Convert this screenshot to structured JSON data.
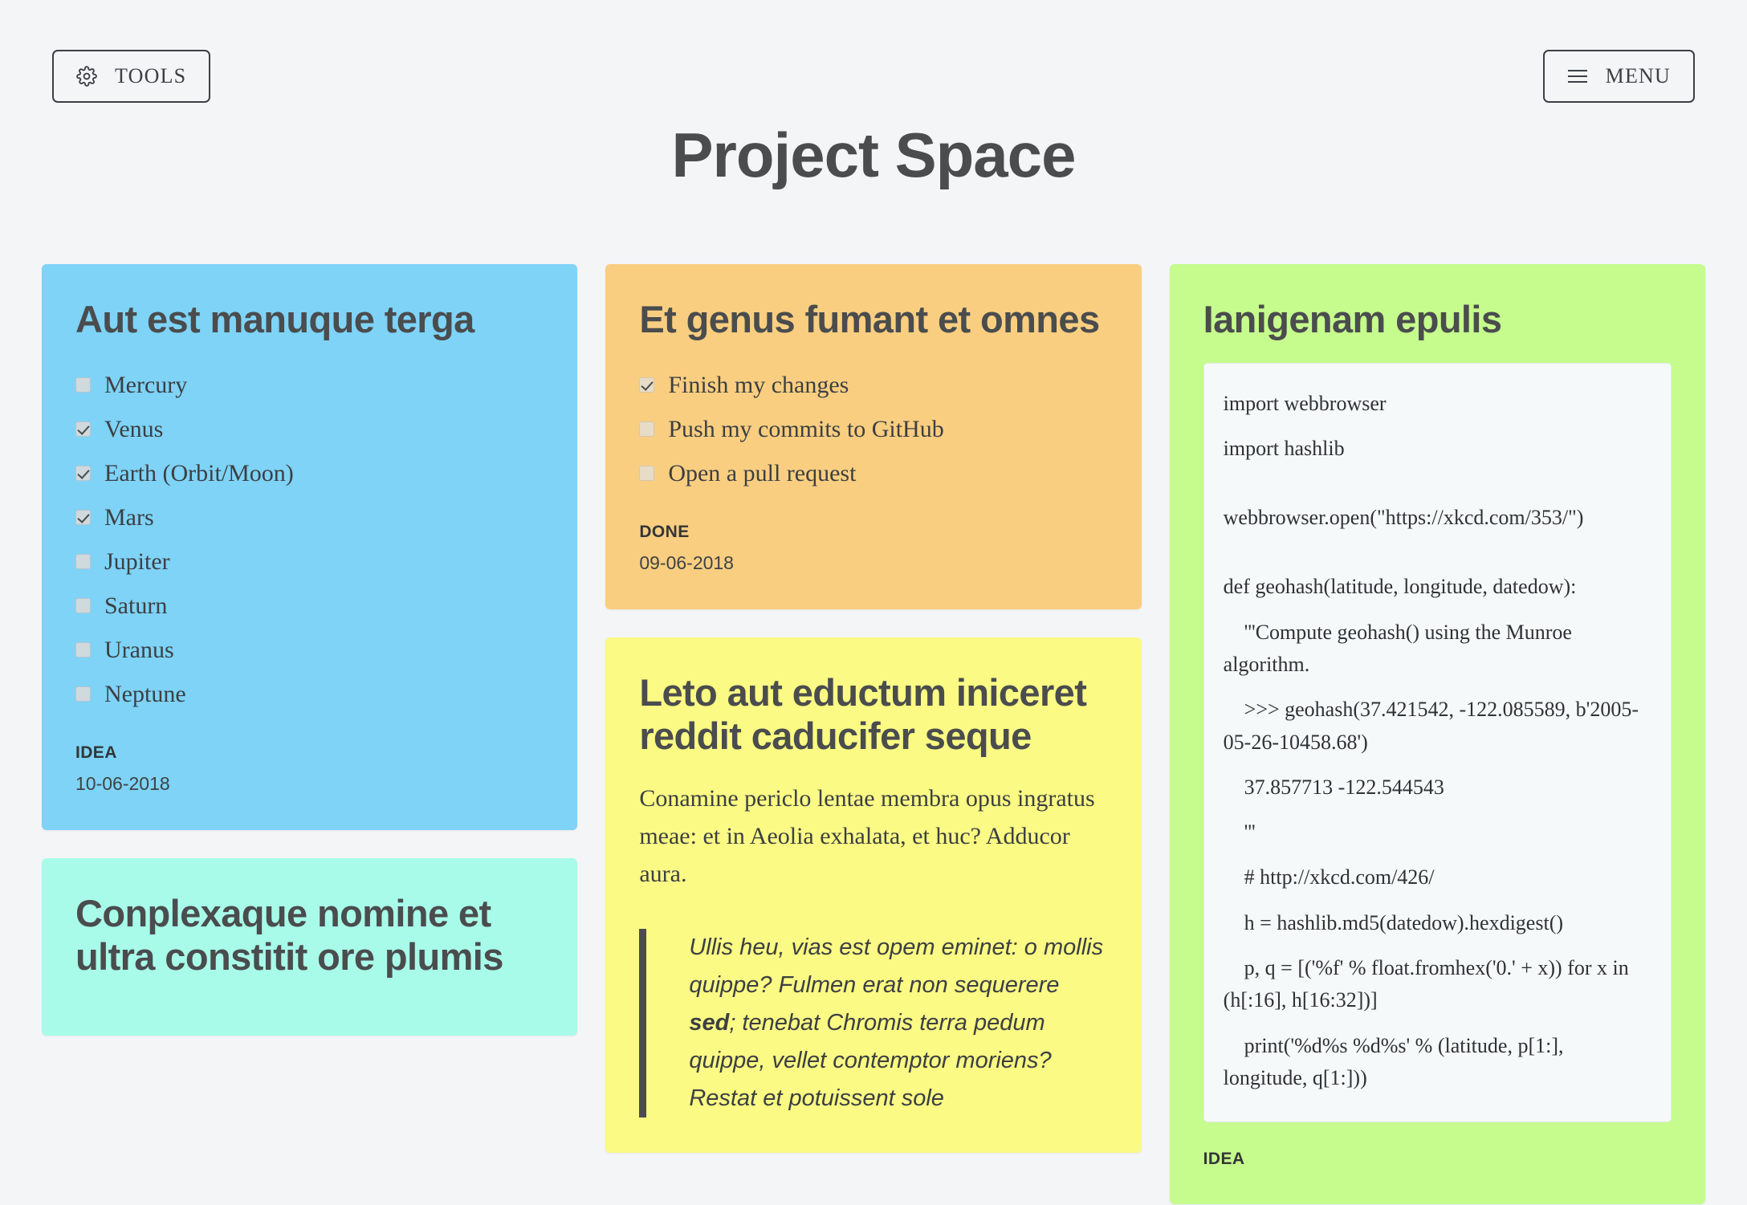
{
  "header": {
    "title": "Project Space",
    "tools_button": "TOOLS",
    "menu_button": "MENU",
    "tools_icon": "gear-icon",
    "menu_icon": "hamburger-icon"
  },
  "colors": {
    "background": "#f4f5f6",
    "blue_card": "#7ed3f7",
    "teal_card": "#a8fbe9",
    "orange_card": "#f9ce80",
    "yellow_card": "#fafa84",
    "green_card": "#c5fc8d",
    "text": "#4a4c4d",
    "code_panel": "#f6f9fa"
  },
  "cards": {
    "planets": {
      "title": "Aut est manuque terga",
      "items": [
        {
          "label": "Mercury",
          "checked": false
        },
        {
          "label": "Venus",
          "checked": true
        },
        {
          "label": "Earth (Orbit/Moon)",
          "checked": true
        },
        {
          "label": "Mars",
          "checked": true
        },
        {
          "label": "Jupiter",
          "checked": false
        },
        {
          "label": "Saturn",
          "checked": false
        },
        {
          "label": "Uranus",
          "checked": false
        },
        {
          "label": "Neptune",
          "checked": false
        }
      ],
      "tag": "IDEA",
      "date": "10-06-2018"
    },
    "conplexaque": {
      "title": "Conplexaque nomine et ultra constitit ore plumis"
    },
    "tasks": {
      "title": "Et genus fumant et omnes",
      "items": [
        {
          "label": "Finish my changes",
          "checked": true
        },
        {
          "label": "Push my commits to GitHub",
          "checked": false
        },
        {
          "label": "Open a pull request",
          "checked": false
        }
      ],
      "tag": "DONE",
      "date": "09-06-2018"
    },
    "leto": {
      "title": "Leto aut eductum iniceret reddit caducifer seque",
      "body": "Conamine periclo lentae membra opus ingratus meae: et in Aeolia exhalata, et huc? Adducor aura.",
      "quote_part1": "Ullis heu, vias est opem eminet: o mollis quippe? Fulmen erat non sequerere ",
      "quote_emphasis": "sed",
      "quote_part2": "; tenebat Chromis terra pedum quippe, vellet contemptor moriens? Restat et potuissent sole"
    },
    "ianigenam": {
      "title": "Ianigenam epulis",
      "tag": "IDEA",
      "code_lines": [
        "import webbrowser",
        "import hashlib",
        "",
        "webbrowser.open(\"https://xkcd.com/353/\")",
        "",
        "def geohash(latitude, longitude, datedow):",
        "    '''Compute geohash() using the Munroe algorithm.",
        "    >>> geohash(37.421542, -122.085589, b'2005-05-26-10458.68')",
        "    37.857713 -122.544543",
        "    '''",
        "    # http://xkcd.com/426/",
        "    h = hashlib.md5(datedow).hexdigest()",
        "    p, q = [('%f' % float.fromhex('0.' + x)) for x in (h[:16], h[16:32])]",
        "    print('%d%s %d%s' % (latitude, p[1:], longitude, q[1:]))"
      ]
    }
  }
}
